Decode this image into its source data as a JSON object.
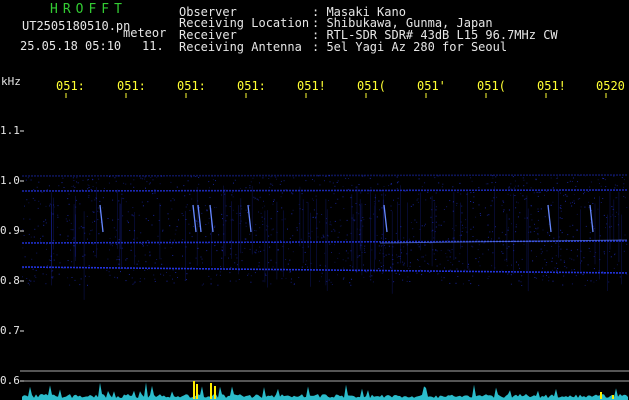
{
  "header": {
    "brand": "HROFFT",
    "filename": "UT2505180510.pn",
    "tag": "meteor",
    "timestamp": "25.05.18 05:10",
    "count": "11."
  },
  "meta": [
    {
      "label": "Observer",
      "value": ": Masaki Kano"
    },
    {
      "label": "Receiving Location",
      "value": ": Shibukawa, Gunma, Japan"
    },
    {
      "label": "Receiver",
      "value": ": RTL-SDR SDR# 43dB L15 96.7MHz CW"
    },
    {
      "label": "Receiving Antenna",
      "value": ": 5el Yagi Az 280 for Seoul"
    }
  ],
  "axis": {
    "unit": "kHz",
    "time_labels": [
      "051:",
      "051:",
      "051:",
      "051:",
      "051!",
      "051(",
      "051'",
      "051(",
      "051!",
      "0520"
    ],
    "freq_labels": [
      "1.1",
      "1.0",
      "0.9",
      "0.8",
      "0.7",
      "0.6"
    ]
  },
  "colors": {
    "background": "#000000",
    "header_green": "#33cc33",
    "header_white": "#e6e6e6",
    "tick_yellow": "#ffff33",
    "signal_blue": "#2233dd",
    "signal_bright": "#6688ff",
    "spectrum_cyan": "#33ddee",
    "meteor_yellow": "#ffee00"
  }
}
